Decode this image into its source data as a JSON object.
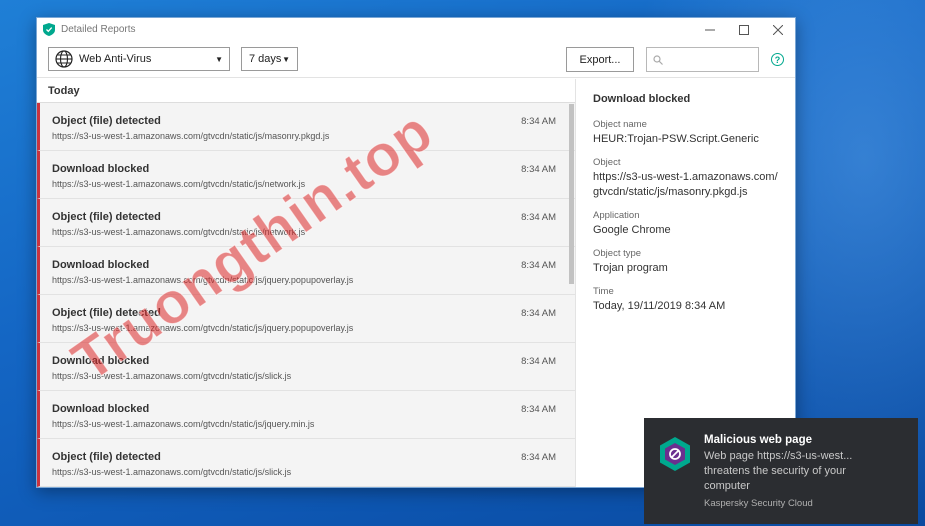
{
  "window": {
    "title": "Detailed Reports",
    "controls": [
      "minimize",
      "maximize",
      "close"
    ]
  },
  "toolbar": {
    "component_selected": "Web Anti-Virus",
    "period_selected": "7 days",
    "export_label": "Export...",
    "search_placeholder": "",
    "help_label": "?"
  },
  "list": {
    "group_label": "Today",
    "items": [
      {
        "title": "Object (file) detected",
        "url": "https://s3-us-west-1.amazonaws.com/gtvcdn/static/js/masonry.pkgd.js",
        "time": "8:34 AM"
      },
      {
        "title": "Download blocked",
        "url": "https://s3-us-west-1.amazonaws.com/gtvcdn/static/js/network.js",
        "time": "8:34 AM"
      },
      {
        "title": "Object (file) detected",
        "url": "https://s3-us-west-1.amazonaws.com/gtvcdn/static/js/network.js",
        "time": "8:34 AM"
      },
      {
        "title": "Download blocked",
        "url": "https://s3-us-west-1.amazonaws.com/gtvcdn/static/js/jquery.popupoverlay.js",
        "time": "8:34 AM"
      },
      {
        "title": "Object (file) detected",
        "url": "https://s3-us-west-1.amazonaws.com/gtvcdn/static/js/jquery.popupoverlay.js",
        "time": "8:34 AM"
      },
      {
        "title": "Download blocked",
        "url": "https://s3-us-west-1.amazonaws.com/gtvcdn/static/js/slick.js",
        "time": "8:34 AM"
      },
      {
        "title": "Download blocked",
        "url": "https://s3-us-west-1.amazonaws.com/gtvcdn/static/js/jquery.min.js",
        "time": "8:34 AM"
      },
      {
        "title": "Object (file) detected",
        "url": "https://s3-us-west-1.amazonaws.com/gtvcdn/static/js/slick.js",
        "time": "8:34 AM"
      }
    ]
  },
  "details": {
    "title": "Download blocked",
    "object_name_label": "Object name",
    "object_name": "HEUR:Trojan-PSW.Script.Generic",
    "object_label": "Object",
    "object_line1": "https://s3-us-west-1.amazonaws.com/",
    "object_line2": "gtvcdn/static/js/masonry.pkgd.js",
    "application_label": "Application",
    "application": "Google Chrome",
    "object_type_label": "Object type",
    "object_type": "Trojan program",
    "time_label": "Time",
    "time": "Today, 19/11/2019 8:34 AM"
  },
  "notification": {
    "title": "Malicious web page",
    "body_line1": "Web page https://s3-us-west...",
    "body_line2": "threatens the security of your",
    "body_line3": "computer",
    "source": "Kaspersky Security Cloud"
  },
  "watermark": "Truongthin.top",
  "colors": {
    "accent": "#00a88e",
    "alert_bar": "#c9343f",
    "toast_bg": "#2b2d31"
  }
}
